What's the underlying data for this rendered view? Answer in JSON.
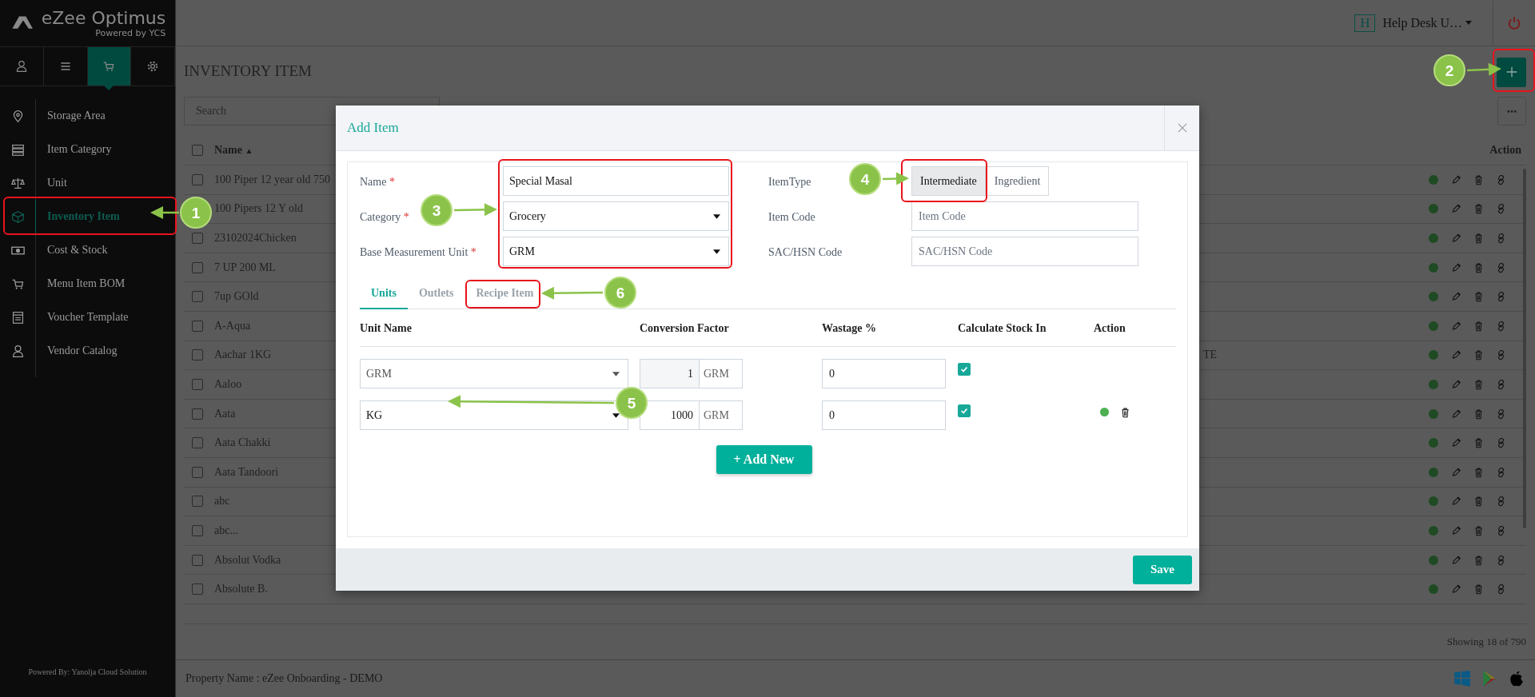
{
  "sidebar": {
    "logo": {
      "title": "eZee Optimus",
      "subtitle": "Powered by YCS"
    },
    "tabs": [
      {
        "selected": false
      },
      {
        "selected": false
      },
      {
        "selected": true
      },
      {
        "selected": false
      }
    ],
    "items": [
      {
        "label": "Storage Area",
        "selected": false
      },
      {
        "label": "Item Category",
        "selected": false
      },
      {
        "label": "Unit",
        "selected": false
      },
      {
        "label": "Inventory Item",
        "selected": true
      },
      {
        "label": "Cost & Stock",
        "selected": false
      },
      {
        "label": "Menu Item BOM",
        "selected": false
      },
      {
        "label": "Voucher Template",
        "selected": false
      },
      {
        "label": "Vendor Catalog",
        "selected": false
      }
    ],
    "footer": "Powered By: Yanolja Cloud Solution"
  },
  "header": {
    "user_initial": "H",
    "user_name": "Help Desk U…"
  },
  "page": {
    "title": "INVENTORY ITEM",
    "search": {
      "placeholder": "Search"
    },
    "table": {
      "all_checked": false,
      "columns": [
        {
          "label": "Name",
          "sort_icon": "▲"
        },
        {
          "label": "Action"
        }
      ],
      "rows": [
        {
          "name": "100 Piper 12 year old 750",
          "checked": false,
          "active": true
        },
        {
          "name": "100 Pipers 12 Y old",
          "active": true
        },
        {
          "name": "23102024Chicken",
          "checked": false,
          "active": true
        },
        {
          "name": "7 UP 200 ML",
          "checked": false,
          "active": true
        },
        {
          "name": "7up GOld",
          "checked": false,
          "active": true
        },
        {
          "name": "A-Aqua",
          "checked": false,
          "active": true
        },
        {
          "name": "Aachar 1KG",
          "checked": false,
          "active": true,
          "column_3": "TE"
        },
        {
          "name": "Aaloo",
          "checked": false,
          "active": true
        },
        {
          "name": "Aata",
          "checked": false,
          "active": true
        },
        {
          "name": "Aata Chakki",
          "checked": false,
          "active": true
        },
        {
          "name": "Aata Tandoori",
          "checked": false,
          "active": true
        },
        {
          "name": "abc",
          "checked": false,
          "active": true
        },
        {
          "name": "abc...",
          "checked": false,
          "active": true
        },
        {
          "name": "Absolut Vodka",
          "checked": false,
          "active": true
        },
        {
          "name": "Absolute B.",
          "checked": false,
          "active": true
        }
      ]
    },
    "showing": "Showing 18 of 790"
  },
  "footer": {
    "property": "Property Name : eZee Onboarding - DEMO"
  },
  "modal": {
    "title": "Add Item",
    "fields": [
      {
        "label": "Name",
        "required_mark": "*",
        "kind": "text",
        "value": "Special Masal"
      },
      {
        "label": "Category",
        "required_mark": "*",
        "kind": "select",
        "value": "Grocery"
      },
      {
        "label": "Base Measurement Unit",
        "required_mark": "*",
        "kind": "select",
        "value": "GRM"
      }
    ],
    "item_type": {
      "label": "ItemType",
      "options": [
        {
          "label": "Intermediate",
          "selected": true
        },
        {
          "label": "Ingredient",
          "selected": false
        }
      ]
    },
    "codes": [
      {
        "label": "Item Code",
        "placeholder": "Item Code"
      },
      {
        "label": "SAC/HSN Code",
        "placeholder": "SAC/HSN Code"
      }
    ],
    "tabs": [
      {
        "label": "Units",
        "selected": true
      },
      {
        "label": "Outlets",
        "selected": false
      },
      {
        "label": "Recipe Item",
        "selected": false
      }
    ],
    "units": {
      "columns": [
        "Unit Name",
        "Conversion Factor",
        "Wastage %",
        "Calculate Stock In",
        "Action"
      ],
      "rows": [
        {
          "unit": "GRM",
          "factor": "1",
          "factor_unit": "GRM",
          "readonly": true,
          "wastage": "0",
          "calculate_stock": true,
          "removable": false
        },
        {
          "unit": "KG",
          "factor": "1000",
          "factor_unit": "GRM",
          "readonly": false,
          "wastage": "0",
          "calculate_stock": true,
          "removable": true,
          "active": true
        }
      ]
    },
    "add_button": "+ Add New",
    "save_button": "Save"
  },
  "annotations": [
    {
      "label": "1"
    },
    {
      "label": "2"
    },
    {
      "label": "3"
    },
    {
      "label": "4"
    },
    {
      "label": "5"
    },
    {
      "label": "6"
    }
  ]
}
